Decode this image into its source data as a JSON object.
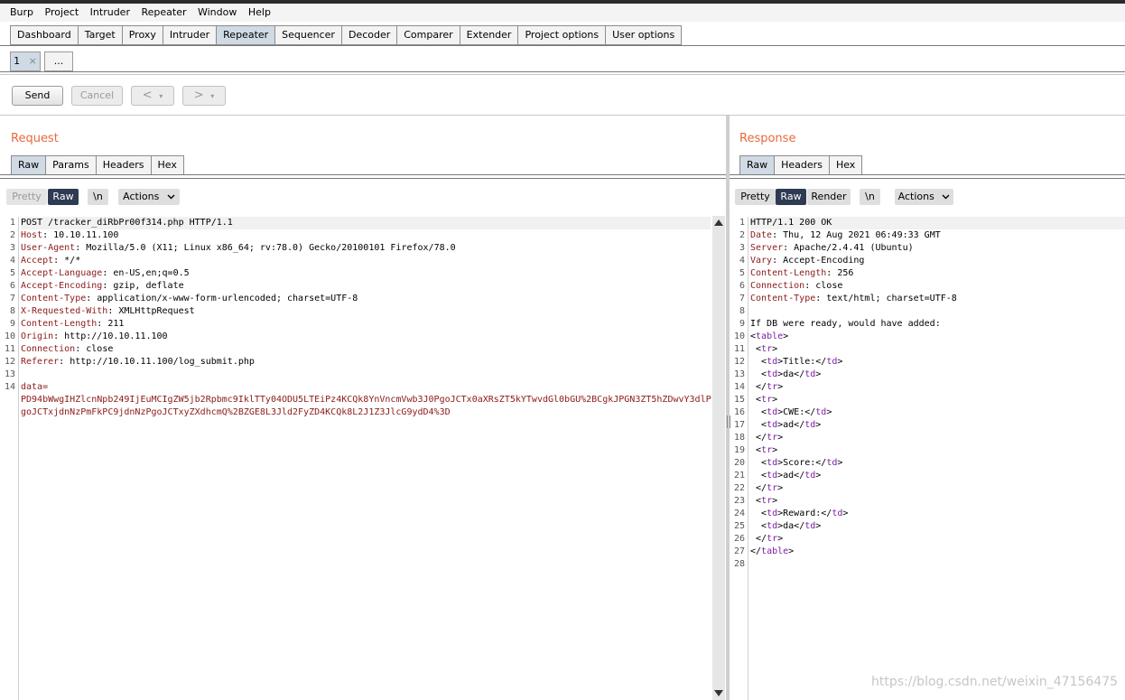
{
  "menu": [
    "Burp",
    "Project",
    "Intruder",
    "Repeater",
    "Window",
    "Help"
  ],
  "main_tabs": [
    {
      "label": "Dashboard",
      "active": false
    },
    {
      "label": "Target",
      "active": false
    },
    {
      "label": "Proxy",
      "active": false
    },
    {
      "label": "Intruder",
      "active": false
    },
    {
      "label": "Repeater",
      "active": true
    },
    {
      "label": "Sequencer",
      "active": false
    },
    {
      "label": "Decoder",
      "active": false
    },
    {
      "label": "Comparer",
      "active": false
    },
    {
      "label": "Extender",
      "active": false
    },
    {
      "label": "Project options",
      "active": false
    },
    {
      "label": "User options",
      "active": false
    }
  ],
  "repeater_tabs": {
    "tab1": "1",
    "close": "×",
    "more": "..."
  },
  "toolbar": {
    "send": "Send",
    "cancel": "Cancel",
    "back": "<",
    "forward": ">",
    "dropdown": "▾"
  },
  "request": {
    "title": "Request",
    "tabs": [
      "Raw",
      "Params",
      "Headers",
      "Hex"
    ],
    "active_tab": "Raw",
    "tools": {
      "pretty": "Pretty",
      "raw": "Raw",
      "newline": "\\n",
      "actions": "Actions"
    },
    "lines": [
      {
        "k": "",
        "v": "POST /tracker_diRbPr00f314.php HTTP/1.1"
      },
      {
        "k": "Host",
        "v": ": 10.10.11.100"
      },
      {
        "k": "User-Agent",
        "v": ": Mozilla/5.0 (X11; Linux x86_64; rv:78.0) Gecko/20100101 Firefox/78.0"
      },
      {
        "k": "Accept",
        "v": ": */*"
      },
      {
        "k": "Accept-Language",
        "v": ": en-US,en;q=0.5"
      },
      {
        "k": "Accept-Encoding",
        "v": ": gzip, deflate"
      },
      {
        "k": "Content-Type",
        "v": ": application/x-www-form-urlencoded; charset=UTF-8"
      },
      {
        "k": "X-Requested-With",
        "v": ": XMLHttpRequest"
      },
      {
        "k": "Content-Length",
        "v": ": 211"
      },
      {
        "k": "Origin",
        "v": ": http://10.10.11.100"
      },
      {
        "k": "Connection",
        "v": ": close"
      },
      {
        "k": "Referer",
        "v": ": http://10.10.11.100/log_submit.php"
      },
      {
        "k": "",
        "v": ""
      },
      {
        "k": "data=",
        "v": ""
      }
    ],
    "body_wrapped": [
      "PD94bWwgIHZlcnNpb249IjEuMCIgZW5jb2Rpbmc9IklTTy04ODU5LTEiPz4KCQk8YnVncmVwb3J0PgoJCTx0aXRsZT5kYTwvdGl0bGU%2BCgkJPGN3ZT5hZDwvY3dlP",
      "goJCTxjdnNzPmFkPC9jdnNzPgoJCTxyZXdhcmQ%2BZGE8L3Jld2FyZD4KCQk8L2J1Z3JlcG9ydD4%3D"
    ]
  },
  "response": {
    "title": "Response",
    "tabs": [
      "Raw",
      "Headers",
      "Hex"
    ],
    "active_tab": "Raw",
    "tools": {
      "pretty": "Pretty",
      "raw": "Raw",
      "render": "Render",
      "newline": "\\n",
      "actions": "Actions"
    },
    "lines": [
      {
        "t": "h",
        "k": "",
        "v": "HTTP/1.1 200 OK"
      },
      {
        "t": "h",
        "k": "Date",
        "v": ": Thu, 12 Aug 2021 06:49:33 GMT"
      },
      {
        "t": "h",
        "k": "Server",
        "v": ": Apache/2.4.41 (Ubuntu)"
      },
      {
        "t": "h",
        "k": "Vary",
        "v": ": Accept-Encoding"
      },
      {
        "t": "h",
        "k": "Content-Length",
        "v": ": 256"
      },
      {
        "t": "h",
        "k": "Connection",
        "v": ": close"
      },
      {
        "t": "h",
        "k": "Content-Type",
        "v": ": text/html; charset=UTF-8"
      },
      {
        "t": "x",
        "i": "",
        "pre": "",
        "tag": "",
        "txt": "",
        "etag": "",
        "post": ""
      },
      {
        "t": "x",
        "i": "",
        "pre": "",
        "tag": "",
        "txt": "If DB were ready, would have added:",
        "etag": "",
        "post": ""
      },
      {
        "t": "x",
        "i": "",
        "pre": "<",
        "tag": "table",
        "txt": ">",
        "etag": "",
        "post": ""
      },
      {
        "t": "x",
        "i": " ",
        "pre": "<",
        "tag": "tr",
        "txt": ">",
        "etag": "",
        "post": ""
      },
      {
        "t": "x",
        "i": "  ",
        "pre": "<",
        "tag": "td",
        "txt": ">Title:</",
        "etag": "td",
        "post": ">"
      },
      {
        "t": "x",
        "i": "  ",
        "pre": "<",
        "tag": "td",
        "txt": ">da</",
        "etag": "td",
        "post": ">"
      },
      {
        "t": "x",
        "i": " ",
        "pre": "</",
        "tag": "tr",
        "txt": ">",
        "etag": "",
        "post": ""
      },
      {
        "t": "x",
        "i": " ",
        "pre": "<",
        "tag": "tr",
        "txt": ">",
        "etag": "",
        "post": ""
      },
      {
        "t": "x",
        "i": "  ",
        "pre": "<",
        "tag": "td",
        "txt": ">CWE:</",
        "etag": "td",
        "post": ">"
      },
      {
        "t": "x",
        "i": "  ",
        "pre": "<",
        "tag": "td",
        "txt": ">ad</",
        "etag": "td",
        "post": ">"
      },
      {
        "t": "x",
        "i": " ",
        "pre": "</",
        "tag": "tr",
        "txt": ">",
        "etag": "",
        "post": ""
      },
      {
        "t": "x",
        "i": " ",
        "pre": "<",
        "tag": "tr",
        "txt": ">",
        "etag": "",
        "post": ""
      },
      {
        "t": "x",
        "i": "  ",
        "pre": "<",
        "tag": "td",
        "txt": ">Score:</",
        "etag": "td",
        "post": ">"
      },
      {
        "t": "x",
        "i": "  ",
        "pre": "<",
        "tag": "td",
        "txt": ">ad</",
        "etag": "td",
        "post": ">"
      },
      {
        "t": "x",
        "i": " ",
        "pre": "</",
        "tag": "tr",
        "txt": ">",
        "etag": "",
        "post": ""
      },
      {
        "t": "x",
        "i": " ",
        "pre": "<",
        "tag": "tr",
        "txt": ">",
        "etag": "",
        "post": ""
      },
      {
        "t": "x",
        "i": "  ",
        "pre": "<",
        "tag": "td",
        "txt": ">Reward:</",
        "etag": "td",
        "post": ">"
      },
      {
        "t": "x",
        "i": "  ",
        "pre": "<",
        "tag": "td",
        "txt": ">da</",
        "etag": "td",
        "post": ">"
      },
      {
        "t": "x",
        "i": " ",
        "pre": "</",
        "tag": "tr",
        "txt": ">",
        "etag": "",
        "post": ""
      },
      {
        "t": "x",
        "i": "",
        "pre": "</",
        "tag": "table",
        "txt": ">",
        "etag": "",
        "post": ""
      },
      {
        "t": "x",
        "i": "",
        "pre": "",
        "tag": "",
        "txt": "",
        "etag": "",
        "post": ""
      }
    ]
  },
  "watermark": "https://blog.csdn.net/weixin_47156475",
  "colors": {
    "accent_title": "#e8693a",
    "active_tab": "#cfdae5",
    "header_key": "#8b1a1a",
    "html_tag": "#7a1fa2",
    "dark_toggle": "#2f3b52"
  }
}
